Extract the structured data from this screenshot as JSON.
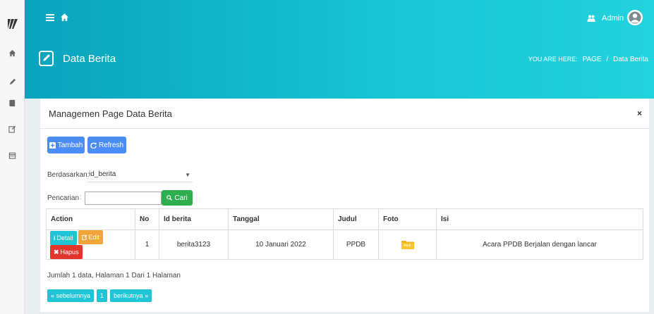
{
  "colors": {
    "header": "#18c6d6",
    "primary": "#4b8df8",
    "success": "#2fae4e",
    "info": "#1fc4d6",
    "warning": "#f2a33a",
    "danger": "#e2352c"
  },
  "sidebar": {
    "logo_icon": "stylized-logo-icon",
    "items": [
      {
        "icon": "home-icon"
      },
      {
        "icon": "pencil-icon"
      },
      {
        "icon": "book-icon"
      },
      {
        "icon": "edit-icon"
      },
      {
        "icon": "calendar-icon"
      }
    ]
  },
  "topbar": {
    "menu_icon": "hamburger-icon",
    "home_icon": "home-icon",
    "user_icon": "users-icon",
    "user_name": "Admin"
  },
  "page": {
    "title": "Data Berita",
    "breadcrumb_prefix": "YOU ARE HERE:",
    "breadcrumb": [
      "PAGE",
      "Data Berita"
    ],
    "breadcrumb_sep": "/"
  },
  "panel": {
    "title": "Managemen Page Data Berita",
    "close": "×",
    "buttons": {
      "tambah": "Tambah",
      "refresh": "Refresh"
    },
    "filter": {
      "label": "Berdasarkan:",
      "selected": "id_berita"
    },
    "search": {
      "label": "Pencarian",
      "value": "",
      "button": "Cari"
    }
  },
  "table": {
    "columns": [
      "Action",
      "No",
      "Id berita",
      "Tanggal",
      "Judul",
      "Foto",
      "Isi"
    ],
    "row_actions": {
      "detail": "Detail",
      "edit": "Edit",
      "hapus": "Hapus"
    },
    "rows": [
      {
        "no": "1",
        "id_berita": "berita3123",
        "tanggal": "10 Januari 2022",
        "judul": "PPDB",
        "foto": "file-folder-icon",
        "foto_label": "FILE",
        "isi": "Acara PPDB Berjalan dengan lancar"
      }
    ]
  },
  "summary": "Jumlah 1 data, Halaman 1 Dari 1 Halaman",
  "pager": {
    "prev": "« sebelumnya",
    "page": "1",
    "next": "berikutnya »"
  }
}
